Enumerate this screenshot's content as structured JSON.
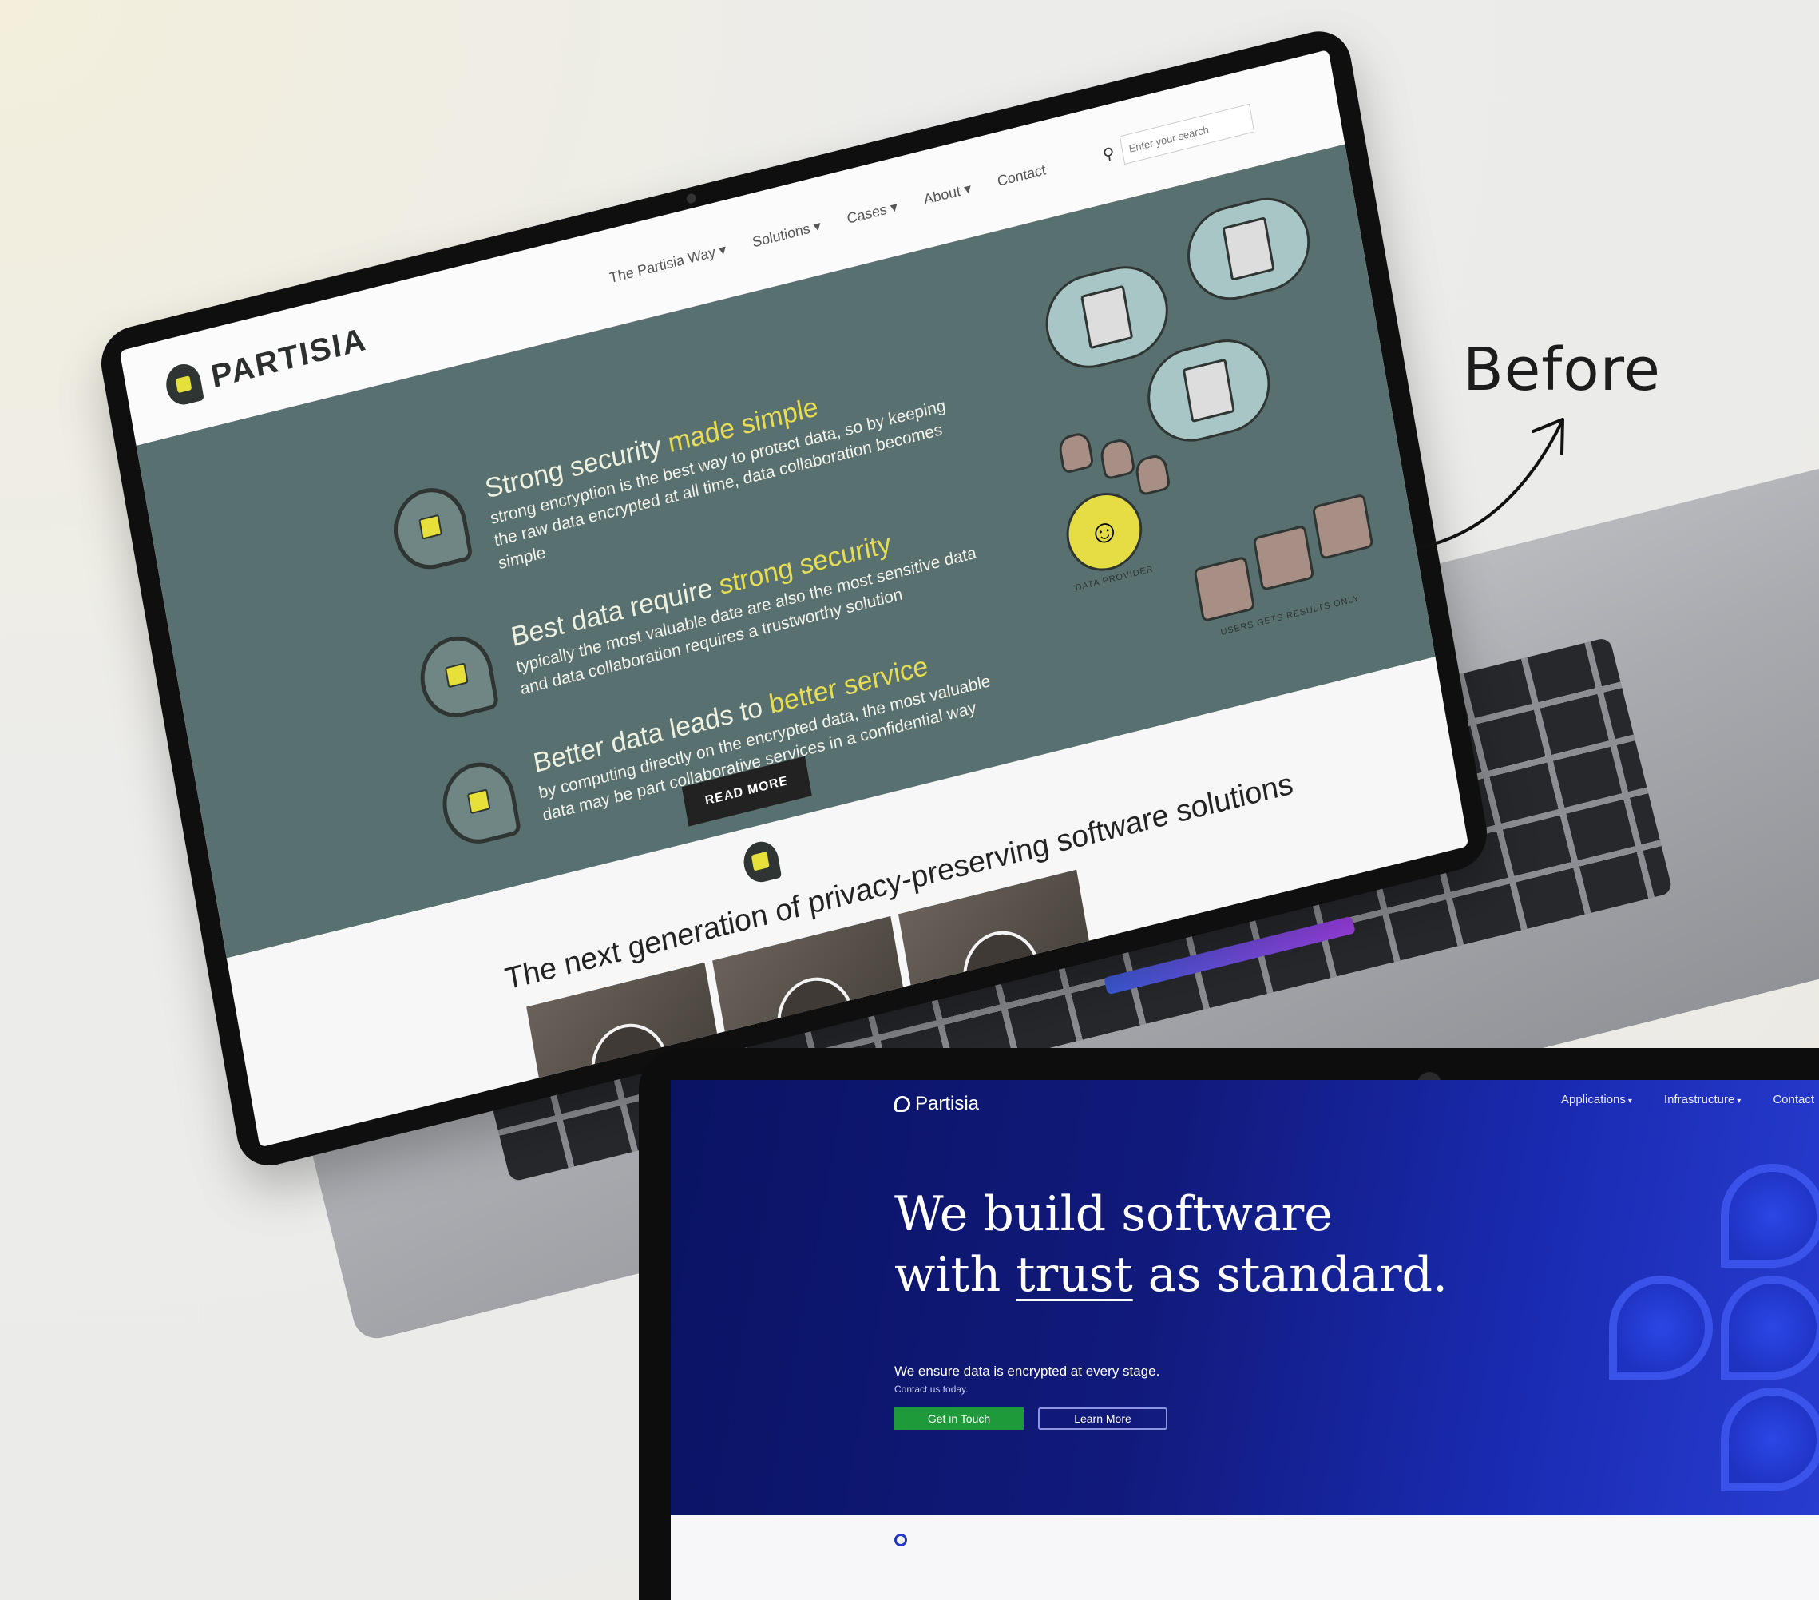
{
  "annotation": {
    "label": "Before"
  },
  "old_site": {
    "logo": "PARTISIA",
    "nav": [
      {
        "label": "The Partisia Way ▾"
      },
      {
        "label": "Solutions ▾"
      },
      {
        "label": "Cases ▾"
      },
      {
        "label": "About ▾"
      },
      {
        "label": "Contact"
      }
    ],
    "search_placeholder": "Enter your search",
    "features": [
      {
        "title_a": "Strong security",
        "title_b": " made simple",
        "desc": "strong encryption is the best way to protect data, so by keeping the raw data encrypted at all time, data collaboration becomes simple"
      },
      {
        "title_a": "Best data require",
        "title_b": " strong security",
        "desc": "typically the most valuable date are also the most sensitive data and data collaboration requires a trustworthy solution"
      },
      {
        "title_a": "Better data leads to",
        "title_b": " better service",
        "desc": "by computing directly on the encrypted data, the most valuable data may be part collaborative services in a confidential way"
      }
    ],
    "read_more": "READ MORE",
    "diagram": {
      "provider_label": "DATA PROVIDER",
      "users_label": "USERS GETS RESULTS ONLY"
    },
    "section_title": "The next generation of privacy-preserving software solutions"
  },
  "new_site": {
    "logo": "Partisia",
    "nav": [
      {
        "label": "Applications",
        "caret": "▾"
      },
      {
        "label": "Infrastructure",
        "caret": "▾"
      },
      {
        "label": "Contact",
        "caret": ""
      }
    ],
    "headline_line1": "We build software",
    "headline_with": "with ",
    "headline_trust": "trust",
    "headline_rest": " as standard.",
    "subtitle": "We ensure data is encrypted at every stage.",
    "subtitle2": "Contact us today.",
    "button_primary": "Get in Touch",
    "button_secondary": "Learn More"
  },
  "colors": {
    "old_hero": "#58706f",
    "old_accent": "#e6dd45",
    "new_hero_dark": "#0a1363",
    "new_hero_bright": "#2a3fd6",
    "new_button": "#1e9a3a"
  }
}
